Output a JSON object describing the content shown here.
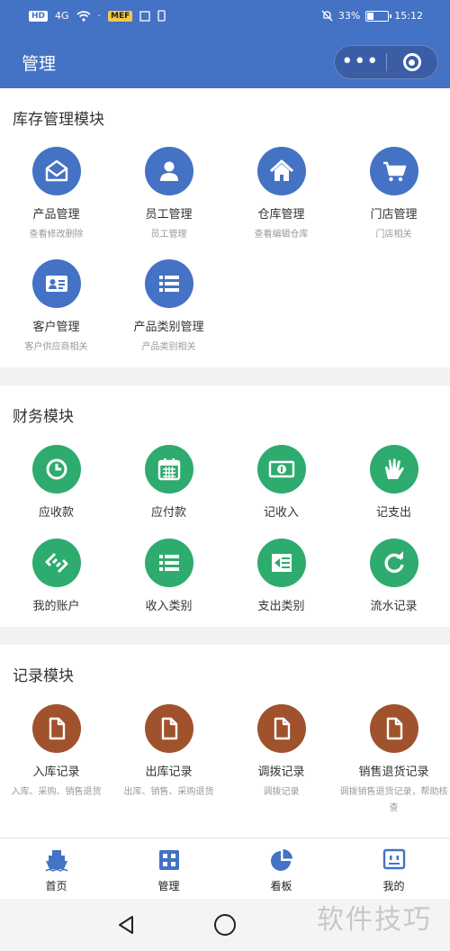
{
  "status_bar": {
    "signal_badge": "HD",
    "network": "4G",
    "app_badge": "MEF",
    "battery_percent": "33%",
    "battery_level": 0.33,
    "time": "15:12"
  },
  "navbar": {
    "title": "管理"
  },
  "sections": [
    {
      "title": "库存管理模块",
      "color": "#4472c4",
      "items": [
        {
          "label": "产品管理",
          "sub": "查看修改删除",
          "icon": "envelope-open-icon"
        },
        {
          "label": "员工管理",
          "sub": "员工管理",
          "icon": "user-icon"
        },
        {
          "label": "仓库管理",
          "sub": "查看编辑仓库",
          "icon": "home-icon"
        },
        {
          "label": "门店管理",
          "sub": "门店相关",
          "icon": "shopping-cart-icon"
        },
        {
          "label": "客户管理",
          "sub": "客户供应商相关",
          "icon": "id-card-icon"
        },
        {
          "label": "产品类别管理",
          "sub": "产品类别相关",
          "icon": "list-icon"
        }
      ]
    },
    {
      "title": "财务模块",
      "color": "#2eab6e",
      "items": [
        {
          "label": "应收款",
          "icon": "clock-icon"
        },
        {
          "label": "应付款",
          "icon": "calendar-icon"
        },
        {
          "label": "记收入",
          "icon": "money-icon"
        },
        {
          "label": "记支出",
          "icon": "hand-icon"
        },
        {
          "label": "我的账户",
          "icon": "exchange-icon"
        },
        {
          "label": "收入类别",
          "icon": "list-icon"
        },
        {
          "label": "支出类别",
          "icon": "outdent-icon"
        },
        {
          "label": "流水记录",
          "icon": "refresh-icon"
        }
      ]
    },
    {
      "title": "记录模块",
      "color": "#a0522d",
      "items": [
        {
          "label": "入库记录",
          "sub": "入库、采购、销售退货",
          "icon": "file-icon"
        },
        {
          "label": "出库记录",
          "sub": "出库、销售、采购退货",
          "icon": "file-icon"
        },
        {
          "label": "调拨记录",
          "sub": "调拨记录",
          "icon": "file-icon"
        },
        {
          "label": "销售退货记录",
          "sub": "调拨销售退货记录，帮助核查",
          "icon": "file-icon"
        }
      ]
    }
  ],
  "tabbar": [
    {
      "label": "首页",
      "icon": "ship-icon",
      "color": "#4472c4"
    },
    {
      "label": "管理",
      "icon": "grid-icon",
      "color": "#4472c4"
    },
    {
      "label": "看板",
      "icon": "pie-chart-icon",
      "color": "#4472c4"
    },
    {
      "label": "我的",
      "icon": "face-box-icon",
      "color": "#4472c4"
    }
  ],
  "watermark": "软件技巧"
}
